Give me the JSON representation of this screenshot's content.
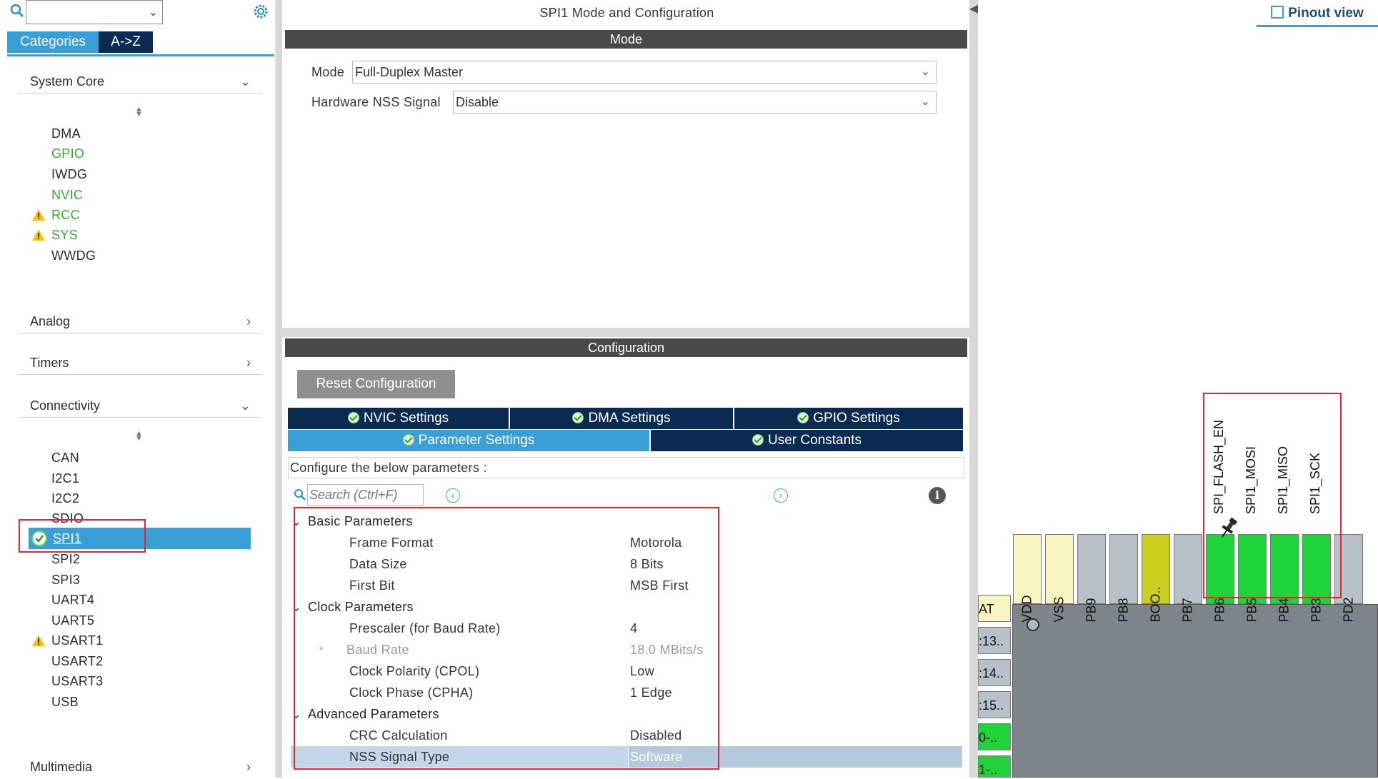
{
  "left": {
    "tabs": [
      "Categories",
      "A->Z"
    ],
    "categories": {
      "system_core": "System Core",
      "analog": "Analog",
      "timers": "Timers",
      "connectivity": "Connectivity",
      "multimedia": "Multimedia"
    },
    "system_core_items": [
      "DMA",
      "GPIO",
      "IWDG",
      "NVIC",
      "RCC",
      "SYS",
      "WWDG"
    ],
    "connectivity_items": [
      "CAN",
      "I2C1",
      "I2C2",
      "SDIO",
      "SPI1",
      "SPI2",
      "SPI3",
      "UART4",
      "UART5",
      "USART1",
      "USART2",
      "USART3",
      "USB"
    ]
  },
  "mid": {
    "title": "SPI1 Mode and Configuration",
    "mode_bar": "Mode",
    "mode_label": "Mode",
    "mode_value": "Full-Duplex Master",
    "nss_label": "Hardware NSS Signal",
    "nss_value": "Disable",
    "config_bar": "Configuration",
    "reset_button": "Reset Configuration",
    "tabs": [
      "NVIC Settings",
      "DMA Settings",
      "GPIO Settings",
      "Parameter Settings",
      "User Constants"
    ],
    "configure_text": "Configure the below parameters :",
    "search_placeholder": "Search (Ctrl+F)",
    "groups": {
      "basic": "Basic Parameters",
      "clock": "Clock Parameters",
      "advanced": "Advanced Parameters"
    },
    "params": [
      {
        "name": "Frame Format",
        "value": "Motorola"
      },
      {
        "name": "Data Size",
        "value": "8 Bits"
      },
      {
        "name": "First Bit",
        "value": "MSB First"
      },
      {
        "name": "Prescaler (for Baud Rate)",
        "value": "4"
      },
      {
        "name": "Baud Rate",
        "value": "18.0 MBits/s"
      },
      {
        "name": "Clock Polarity (CPOL)",
        "value": "Low"
      },
      {
        "name": "Clock Phase (CPHA)",
        "value": "1 Edge"
      },
      {
        "name": "CRC Calculation",
        "value": "Disabled"
      },
      {
        "name": "NSS Signal Type",
        "value": "Software"
      }
    ],
    "baud_marker": "*"
  },
  "right": {
    "pinout_view": "Pinout view",
    "signal_labels": [
      "SPI_FLASH_EN",
      "SPI1_MOSI",
      "SPI1_MISO",
      "SPI1_SCK"
    ],
    "pins": [
      "VDD",
      "VSS",
      "PB9",
      "PB8",
      "BOO..",
      "PB7",
      "PB6",
      "PB5",
      "PB4",
      "PB3",
      "PD2"
    ],
    "left_pins": [
      "AT",
      ":13..",
      ":14..",
      ":15..",
      "0-..",
      "1-.."
    ]
  },
  "colors": {
    "tab_active": "#3a9fd6",
    "tab_dark": "#0b2b52",
    "pin_green": "#1fd33a",
    "pin_gray": "#b8c0c8",
    "pin_yellow": "#f8f5c2",
    "pin_olive": "#c9cf1c",
    "highlight_red": "#e8262b",
    "selected_row": "#c4d6ea"
  }
}
